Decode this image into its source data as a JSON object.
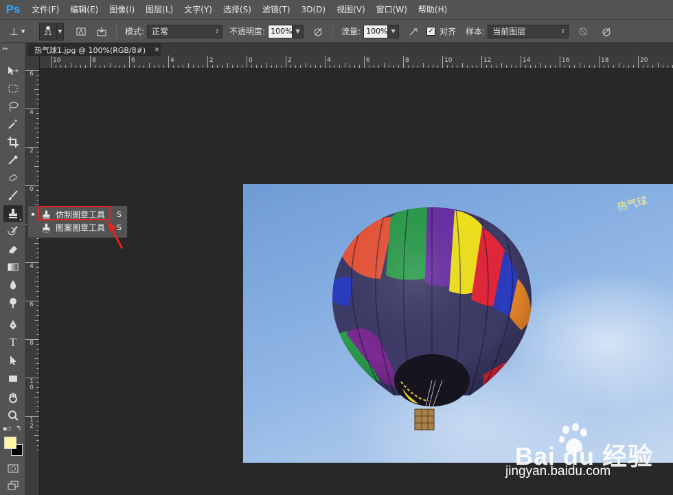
{
  "app": {
    "logo": "Ps"
  },
  "menu": [
    "文件(F)",
    "编辑(E)",
    "图像(I)",
    "图层(L)",
    "文字(Y)",
    "选择(S)",
    "滤镜(T)",
    "3D(D)",
    "视图(V)",
    "窗口(W)",
    "帮助(H)"
  ],
  "options": {
    "brush_size": "21",
    "mode_label": "模式:",
    "mode_value": "正常",
    "opacity_label": "不透明度:",
    "opacity_value": "100%",
    "flow_label": "流量:",
    "flow_value": "100%",
    "aligned_label": "对齐",
    "aligned_checked": true,
    "sample_label": "样本:",
    "sample_value": "当前图层"
  },
  "document": {
    "tab_title": "热气球1.jpg @ 100%(RGB/8#)",
    "close_glyph": "×"
  },
  "ruler": {
    "top_labels": [
      "10",
      "8",
      "6",
      "4",
      "2",
      "0",
      "2",
      "4",
      "6",
      "8",
      "10",
      "12",
      "14",
      "16",
      "18",
      "20"
    ],
    "left_labels": [
      "6",
      "4",
      "2",
      "0",
      "2",
      "4",
      "6",
      "8",
      "10",
      "12"
    ]
  },
  "toolbar": {
    "tools": [
      "move-tool",
      "marquee-tool",
      "lasso-tool",
      "magic-wand-tool",
      "crop-tool",
      "eyedropper-tool",
      "healing-brush-tool",
      "brush-tool",
      "clone-stamp-tool",
      "history-brush-tool",
      "eraser-tool",
      "gradient-tool",
      "blur-tool",
      "dodge-tool",
      "pen-tool",
      "type-tool",
      "path-selection-tool",
      "rectangle-tool",
      "hand-tool",
      "zoom-tool"
    ],
    "foreground_color": "#fff6a0",
    "background_color": "#000000"
  },
  "flyout": {
    "items": [
      {
        "label": "仿制图章工具",
        "key": "S",
        "selected": true
      },
      {
        "label": "图案图章工具",
        "key": "S",
        "selected": false
      }
    ],
    "highlight_color": "#e02323"
  },
  "canvas": {
    "watermark_text": "热气球"
  },
  "baidu": {
    "logo": "Bai du 经验",
    "url": "jingyan.baidu.com"
  }
}
